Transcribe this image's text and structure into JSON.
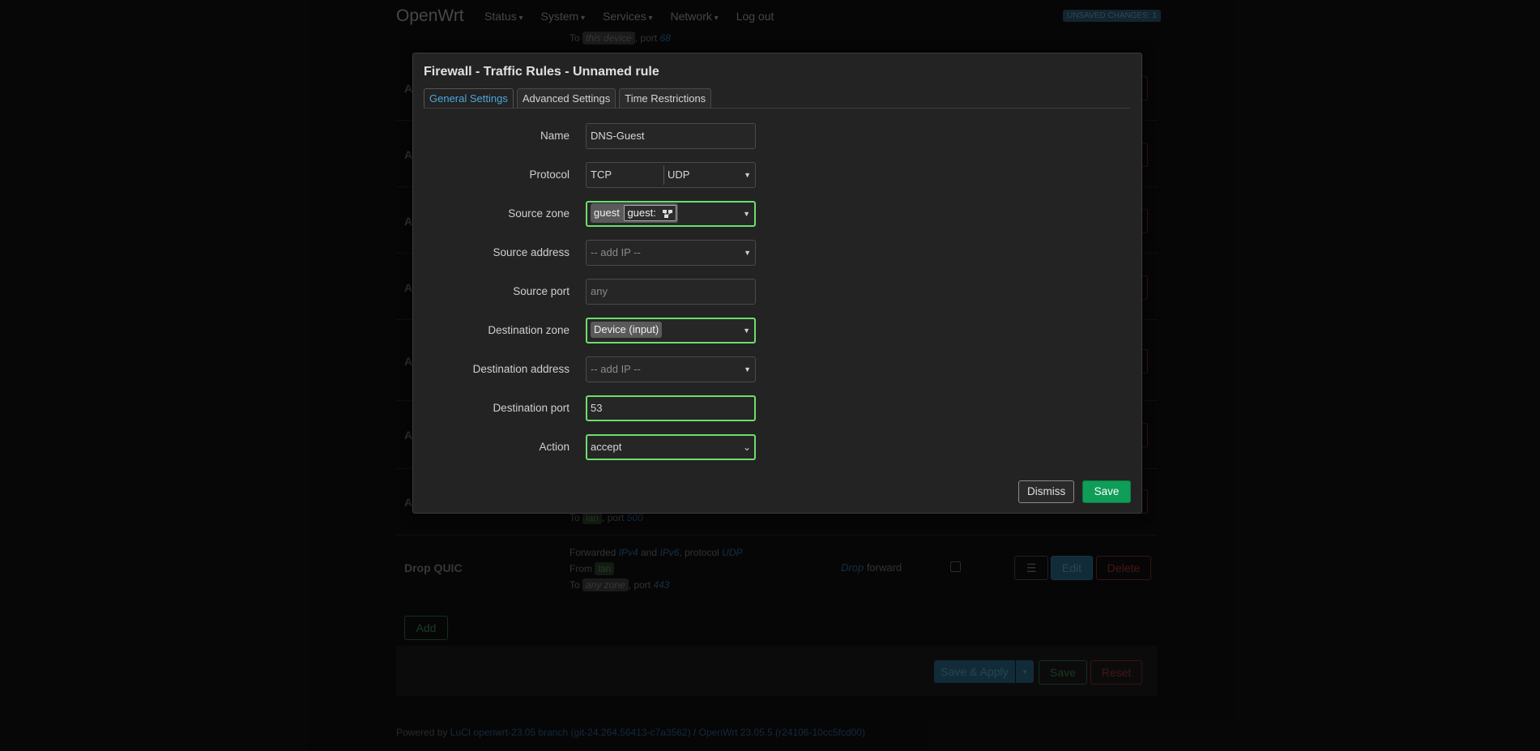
{
  "header": {
    "brand": "OpenWrt",
    "menu": [
      "Status",
      "System",
      "Services",
      "Network",
      "Log out"
    ],
    "unsaved": "UNSAVED CHANGES: 1"
  },
  "background": {
    "top_line_to": "To",
    "top_line_tag": "this device",
    "top_line_port_label": ", port",
    "top_line_port": "68",
    "row_letters": [
      "A",
      "A",
      "A",
      "A",
      "A",
      "A",
      "A"
    ],
    "to_lan_line": {
      "to": "To",
      "tag": "lan",
      "port_label": ", port",
      "port": "500"
    },
    "drop_quic": {
      "name": "Drop QUIC",
      "line1_prefix": "Forwarded",
      "ipv4": "IPv4",
      "and": "and",
      "ipv6": "IPv6",
      "protocol_label": ", protocol",
      "protocol": "UDP",
      "from_label": "From",
      "from_tag": "lan",
      "to_label": "To",
      "to_tag": "any zone",
      "port_label": ", port",
      "port": "443",
      "action": "Drop",
      "action_suffix": "forward",
      "menu_icon": "☰",
      "edit": "Edit",
      "delete": "Delete"
    },
    "add_button": "Add",
    "save_apply": "Save & Apply",
    "save": "Save",
    "reset": "Reset",
    "footer": {
      "powered_by": "Powered by",
      "luci": "LuCI openwrt-23.05 branch (git-24.264.56413-c7a3562)",
      "separator": " / ",
      "openwrt": "OpenWrt 23.05.5 (r24106-10cc5fcd00)"
    }
  },
  "modal": {
    "title": "Firewall - Traffic Rules - Unnamed rule",
    "tabs": [
      "General Settings",
      "Advanced Settings",
      "Time Restrictions"
    ],
    "fields": {
      "name": {
        "label": "Name",
        "value": "DNS-Guest"
      },
      "protocol": {
        "label": "Protocol",
        "value1": "TCP",
        "value2": "UDP"
      },
      "source_zone": {
        "label": "Source zone",
        "chip1": "guest",
        "chip2": "guest:"
      },
      "source_address": {
        "label": "Source address",
        "placeholder": "-- add IP --"
      },
      "source_port": {
        "label": "Source port",
        "placeholder": "any"
      },
      "destination_zone": {
        "label": "Destination zone",
        "chip1": "Device",
        "chip2": "(input)"
      },
      "destination_address": {
        "label": "Destination address",
        "placeholder": "-- add IP --"
      },
      "destination_port": {
        "label": "Destination port",
        "value": "53"
      },
      "action": {
        "label": "Action",
        "value": "accept"
      }
    },
    "dismiss": "Dismiss",
    "save": "Save"
  },
  "colors": {
    "valid_border": "#6cde6c",
    "save_green": "#0f9d58",
    "tab_active": "#4ea6d9"
  }
}
